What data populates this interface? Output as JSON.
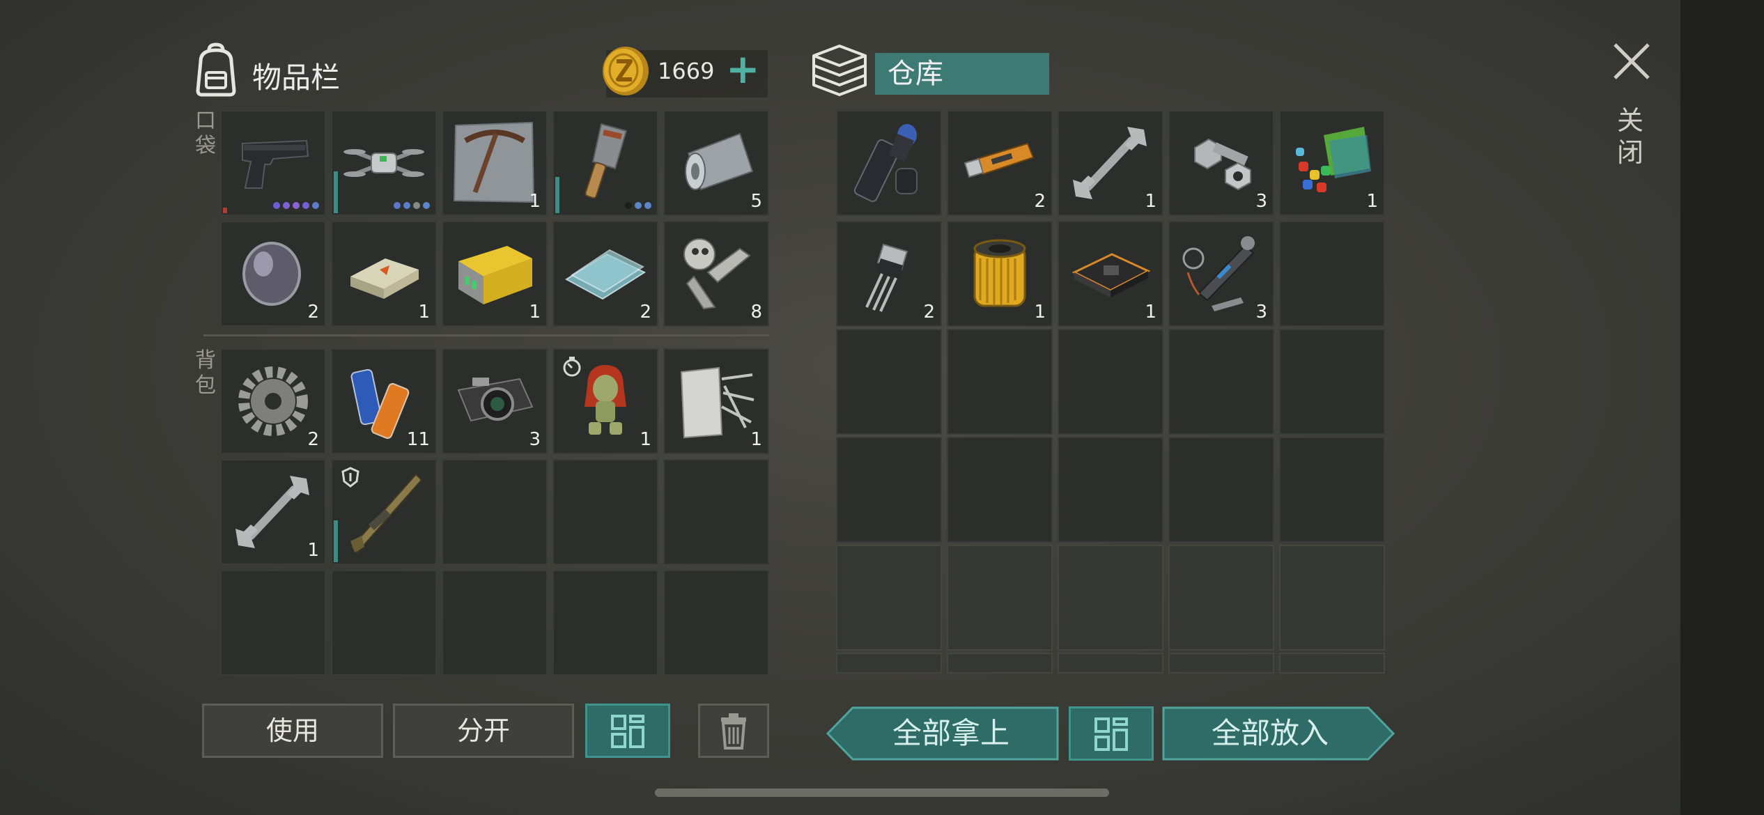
{
  "header": {
    "inventory_title": "物品栏",
    "coins": "1669",
    "storage_title": "仓库",
    "close_label": "关闭"
  },
  "side_labels": {
    "pocket": "口袋",
    "backpack": "背包"
  },
  "buttons": {
    "use": "使用",
    "split": "分开",
    "take_all": "全部拿上",
    "put_all": "全部放入"
  },
  "colors": {
    "accent_teal": "#3f8c86",
    "coin_gold": "#d9a520",
    "durability_red": "#b43a36"
  },
  "inventory_pocket": [
    {
      "icon": "pistol-icon",
      "count": "",
      "durability": 0.05,
      "durability_color": "red",
      "quality_dots": 5
    },
    {
      "icon": "drone-icon",
      "count": "",
      "durability": 0.5,
      "quality_dots": 4
    },
    {
      "icon": "pickaxe-blueprint-icon",
      "count": "1"
    },
    {
      "icon": "cleaver-icon",
      "count": "",
      "durability": 0.4,
      "quality_dots": 3
    },
    {
      "icon": "metal-sheet-roll-icon",
      "count": "5"
    },
    {
      "icon": "lens-icon",
      "count": "2"
    },
    {
      "icon": "explosive-brick-icon",
      "count": "1"
    },
    {
      "icon": "battery-pack-icon",
      "count": "1"
    },
    {
      "icon": "glass-panes-icon",
      "count": "2"
    },
    {
      "icon": "mechanical-parts-icon",
      "count": "8"
    }
  ],
  "inventory_backpack": [
    {
      "icon": "gear-icon",
      "count": "2"
    },
    {
      "icon": "batteries-icon",
      "count": "11"
    },
    {
      "icon": "camera-icon",
      "count": "3"
    },
    {
      "icon": "zombie-doll-icon",
      "count": "1",
      "badge": "timer"
    },
    {
      "icon": "fiber-cloth-icon",
      "count": "1"
    },
    {
      "icon": "wrench-icon",
      "count": "1"
    },
    {
      "icon": "rifle-icon",
      "count": "",
      "badge": "shield",
      "durability": 0.4
    }
  ],
  "storage": [
    {
      "icon": "flashlight-icon",
      "count": ""
    },
    {
      "icon": "usb-drive-icon",
      "count": "2"
    },
    {
      "icon": "wrench-icon",
      "count": "1"
    },
    {
      "icon": "bolt-nut-icon",
      "count": "3"
    },
    {
      "icon": "plastic-materials-icon",
      "count": "1"
    },
    {
      "icon": "transistor-icon",
      "count": "2"
    },
    {
      "icon": "air-filter-icon",
      "count": "1"
    },
    {
      "icon": "circuit-board-icon",
      "count": "1"
    },
    {
      "icon": "motor-parts-icon",
      "count": "3"
    }
  ]
}
